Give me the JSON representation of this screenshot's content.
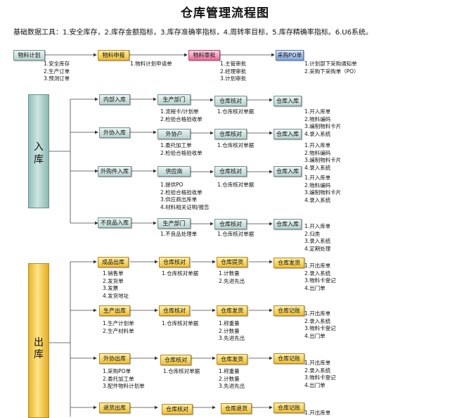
{
  "title": "仓库管理流程图",
  "subtitle": "基础数据工具：1.安全库存，2.库存金额指标，3.库存准确率指标，4.周转率目标，5.库存精确率指标。6.U6系统。",
  "top_flow": {
    "nodes": [
      "物料计划",
      "物料申报",
      "物料审批",
      "采购PO单"
    ],
    "notes": [
      [
        "1.安全库存",
        "2.生产订单",
        "3.预测订单"
      ],
      [
        "1.物料计划申请单"
      ],
      [
        "1.主管审批",
        "2.经理审批",
        "3.计划审批"
      ],
      [
        "1.计划部下采购通知单",
        "2.采购下采购单（PO）"
      ]
    ]
  },
  "inbound": {
    "label_1": "入",
    "label_2": "库",
    "rows": [
      {
        "type": "内部入库",
        "src": "生产部门",
        "check": "仓库核对",
        "end": "仓库入库",
        "notes_src": [
          "1.流程卡/计划单",
          "2.检验合格验收单"
        ],
        "notes_check": [
          "1.仓库核对单据"
        ],
        "notes_end": [
          "1.开入库单",
          "2.物料编码",
          "3.编制物料卡片",
          "4.录入系统"
        ]
      },
      {
        "type": "外协入库",
        "src": "外协户",
        "check": "仓库核对",
        "end": "仓库入库",
        "notes_src": [
          "1.委托加工单",
          "2.检验合格验收单"
        ],
        "notes_check": [
          "1.仓库核对单据"
        ],
        "notes_end": [
          "1.开入库单",
          "2.物料编码",
          "3.编制物料卡片",
          "4.录入系统"
        ]
      },
      {
        "type": "外购件入库",
        "src": "供应商",
        "check": "仓库核对",
        "end": "仓库入库",
        "notes_src": [
          "1.提供PO",
          "2.检验合格验收单",
          "3.供应商出库单",
          "4.材料相关证明/报告"
        ],
        "notes_check": [
          "1.仓库核对单据"
        ],
        "notes_end": [
          "1.开入库单",
          "2.物料编码",
          "3.编制物料卡片",
          "4.录入系统"
        ]
      },
      {
        "type": "不良品入库",
        "src": "生产部门",
        "check": "仓库核对",
        "end": "仓库入库",
        "notes_src": [
          "1.不良品处理单"
        ],
        "notes_check": [
          "1.仓库核对单据"
        ],
        "notes_end": [
          "1.开入库单",
          "2.归类",
          "3.录入系统",
          "4.定期处理"
        ]
      }
    ]
  },
  "outbound": {
    "label_1": "出",
    "label_2": "库",
    "rows": [
      {
        "type": "成品出库",
        "check": "仓库核对",
        "act": "仓库提货",
        "end": "仓库发货",
        "notes_type": [
          "1.销售单",
          "2.发货单",
          "3.发票",
          "4.发货地址"
        ],
        "notes_check": [
          "1.仓库核对单据"
        ],
        "notes_act": [
          "1.计数量",
          "2.先进先出"
        ],
        "notes_end": [
          "1.开出库单",
          "2.录入系统",
          "3.物料卡登记",
          "4.出门单"
        ]
      },
      {
        "type": "生产出库",
        "check": "仓库核对",
        "act": "仓库发货",
        "end": "仓库记账",
        "notes_type": [
          "1.生产计划单",
          "2.生产材料单"
        ],
        "notes_check": [
          "1.仓库核对单据"
        ],
        "notes_act": [
          "1.称重量",
          "2.计数量",
          "3.先进先出"
        ],
        "notes_end": [
          "1.开出库单",
          "2.录入系统",
          "3.物料卡登记",
          "4.出门单"
        ]
      },
      {
        "type": "外协出库",
        "check": "仓库核对",
        "act": "仓库发货",
        "end": "仓库记账",
        "notes_type": [
          "1.采购PO单",
          "2.委托加工单",
          "3.配件物料计划单"
        ],
        "notes_check": [
          "1.仓库核对单据"
        ],
        "notes_act": [
          "1.称重量",
          "2.计数量",
          "3.先进先出"
        ],
        "notes_end": [
          "1.开出库单",
          "2.录入系统",
          "3.物料卡登记",
          "4.出门单"
        ]
      },
      {
        "type": "退货出库",
        "check": "仓库核对",
        "act": "仓库退货",
        "end": "仓库记账",
        "notes_type": [],
        "notes_check": [],
        "notes_act": [],
        "notes_end": [
          "1.开出库单"
        ]
      }
    ]
  }
}
